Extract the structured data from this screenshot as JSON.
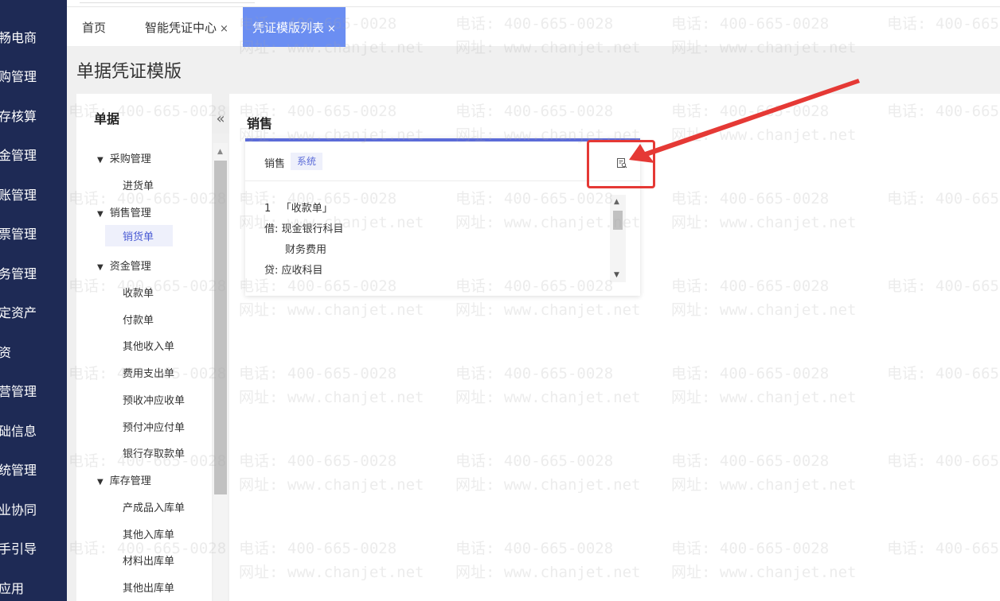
{
  "sidebar": {
    "items": [
      {
        "label": "畅电商"
      },
      {
        "label": "购管理"
      },
      {
        "label": "存核算"
      },
      {
        "label": "金管理"
      },
      {
        "label": "账管理"
      },
      {
        "label": "票管理"
      },
      {
        "label": "务管理"
      },
      {
        "label": "定资产"
      },
      {
        "label": "资"
      },
      {
        "label": "营管理"
      },
      {
        "label": "础信息"
      },
      {
        "label": "统管理"
      },
      {
        "label": "业协同"
      },
      {
        "label": "手引导"
      },
      {
        "label": "应用"
      }
    ]
  },
  "tabs": [
    {
      "label": "首页",
      "closable": false
    },
    {
      "label": "智能凭证中心",
      "closable": true
    },
    {
      "label": "凭证模版列表",
      "closable": true,
      "active": true
    }
  ],
  "tab_close_glyph": "×",
  "page_title": "单据凭证模版",
  "doc_panel": {
    "title": "单据",
    "collapse_glyph": "«",
    "groups": [
      {
        "label": "采购管理",
        "items": [
          "进货单"
        ]
      },
      {
        "label": "销售管理",
        "items": [
          "销货单"
        ],
        "active_item": "销货单"
      },
      {
        "label": "资金管理",
        "items": [
          "收款单",
          "付款单",
          "其他收入单",
          "费用支出单",
          "预收冲应收单",
          "预付冲应付单",
          "银行存取款单"
        ]
      },
      {
        "label": "库存管理",
        "items": [
          "产成品入库单",
          "其他入库单",
          "材料出库单",
          "其他出库单"
        ]
      }
    ]
  },
  "main": {
    "section_title": "销售",
    "card": {
      "name": "销售",
      "badge": "系统",
      "lines": [
        {
          "num": "1",
          "text": "「收款单」"
        },
        {
          "num": "借:",
          "text": "现金银行科目"
        },
        {
          "num": "",
          "text": "财务费用"
        },
        {
          "num": "贷:",
          "text": "应收科目"
        }
      ]
    }
  },
  "watermark": {
    "phone": "电话: 400-665-0028",
    "site": "网址: www.chanjet.net"
  },
  "colors": {
    "sidebar_bg": "#1e2a55",
    "active_tab": "#6b8ef2",
    "accent": "#5b6bd8",
    "highlight": "#e53935"
  }
}
